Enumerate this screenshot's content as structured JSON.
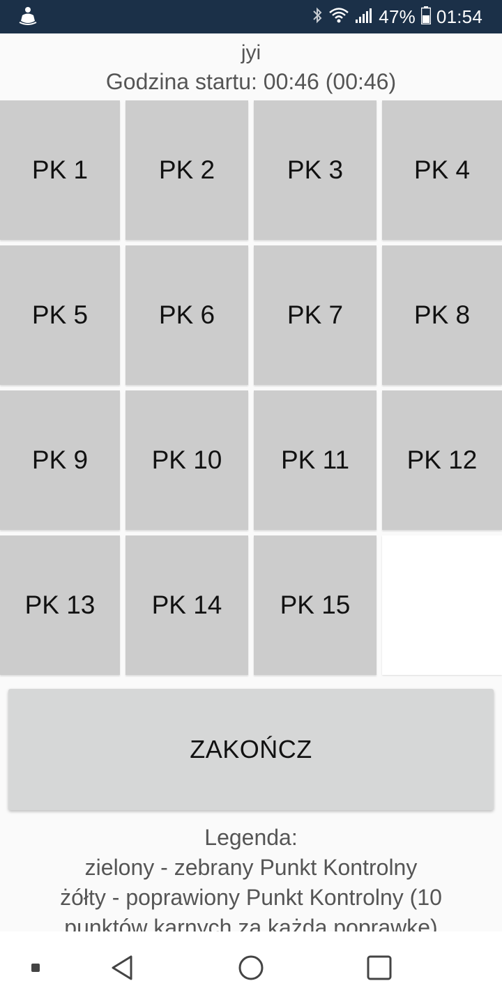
{
  "status_bar": {
    "battery": "47%",
    "time": "01:54",
    "icons": [
      "app-notification-icon",
      "bluetooth-icon",
      "wifi-icon",
      "signal-icon",
      "battery-icon"
    ]
  },
  "header": {
    "team_name": "jyi",
    "start_time": "Godzina startu: 00:46 (00:46)"
  },
  "checkpoints": [
    {
      "label": "PK 1"
    },
    {
      "label": "PK 2"
    },
    {
      "label": "PK 3"
    },
    {
      "label": "PK 4"
    },
    {
      "label": "PK 5"
    },
    {
      "label": "PK 6"
    },
    {
      "label": "PK 7"
    },
    {
      "label": "PK 8"
    },
    {
      "label": "PK 9"
    },
    {
      "label": "PK 10"
    },
    {
      "label": "PK 11"
    },
    {
      "label": "PK 12"
    },
    {
      "label": "PK 13"
    },
    {
      "label": "PK 14"
    },
    {
      "label": "PK 15"
    }
  ],
  "finish_button": "ZAKOŃCZ",
  "legend": {
    "title": "Legenda:",
    "line1": "zielony - zebrany Punkt Kontrolny",
    "line2": "żółty - poprawiony Punkt Kontrolny (10",
    "line3": "punktów karnych za każdą poprawkę)"
  },
  "nav_bar": {
    "icons": [
      "recent-dot-icon",
      "back-icon",
      "home-icon",
      "overview-icon"
    ]
  },
  "colors": {
    "status_bar_bg": "#1b3048",
    "tile_bg": "#cccccc",
    "button_bg": "#d6d7d7"
  }
}
